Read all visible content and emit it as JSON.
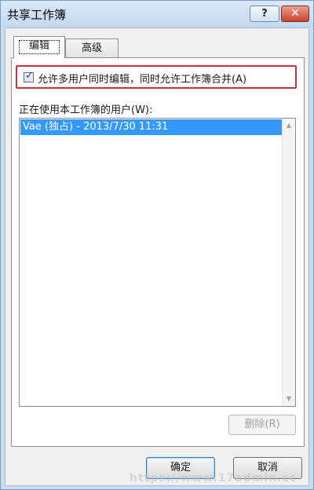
{
  "window": {
    "title": "共享工作簿",
    "help_label": "?",
    "close_label": "✕"
  },
  "tabs": [
    {
      "label": "编辑",
      "selected": true
    },
    {
      "label": "高级",
      "selected": false
    }
  ],
  "edit_tab": {
    "allow_multi_user_checked": true,
    "checkbox_glyph": "✓",
    "allow_multi_user_label": "允许多用户同时编辑，同时允许工作簿合并(A)",
    "users_label": "正在使用本工作簿的用户(W):",
    "users": [
      "Vae (独占) - 2013/7/30 11:31"
    ],
    "remove_label": "删除(R)"
  },
  "footer": {
    "ok_label": "确定",
    "cancel_label": "取消"
  },
  "watermark": "https://www.17admin.cc",
  "colors": {
    "highlight_border": "#c8323a",
    "selection": "#3399ff",
    "close_button": "#c7452c"
  }
}
